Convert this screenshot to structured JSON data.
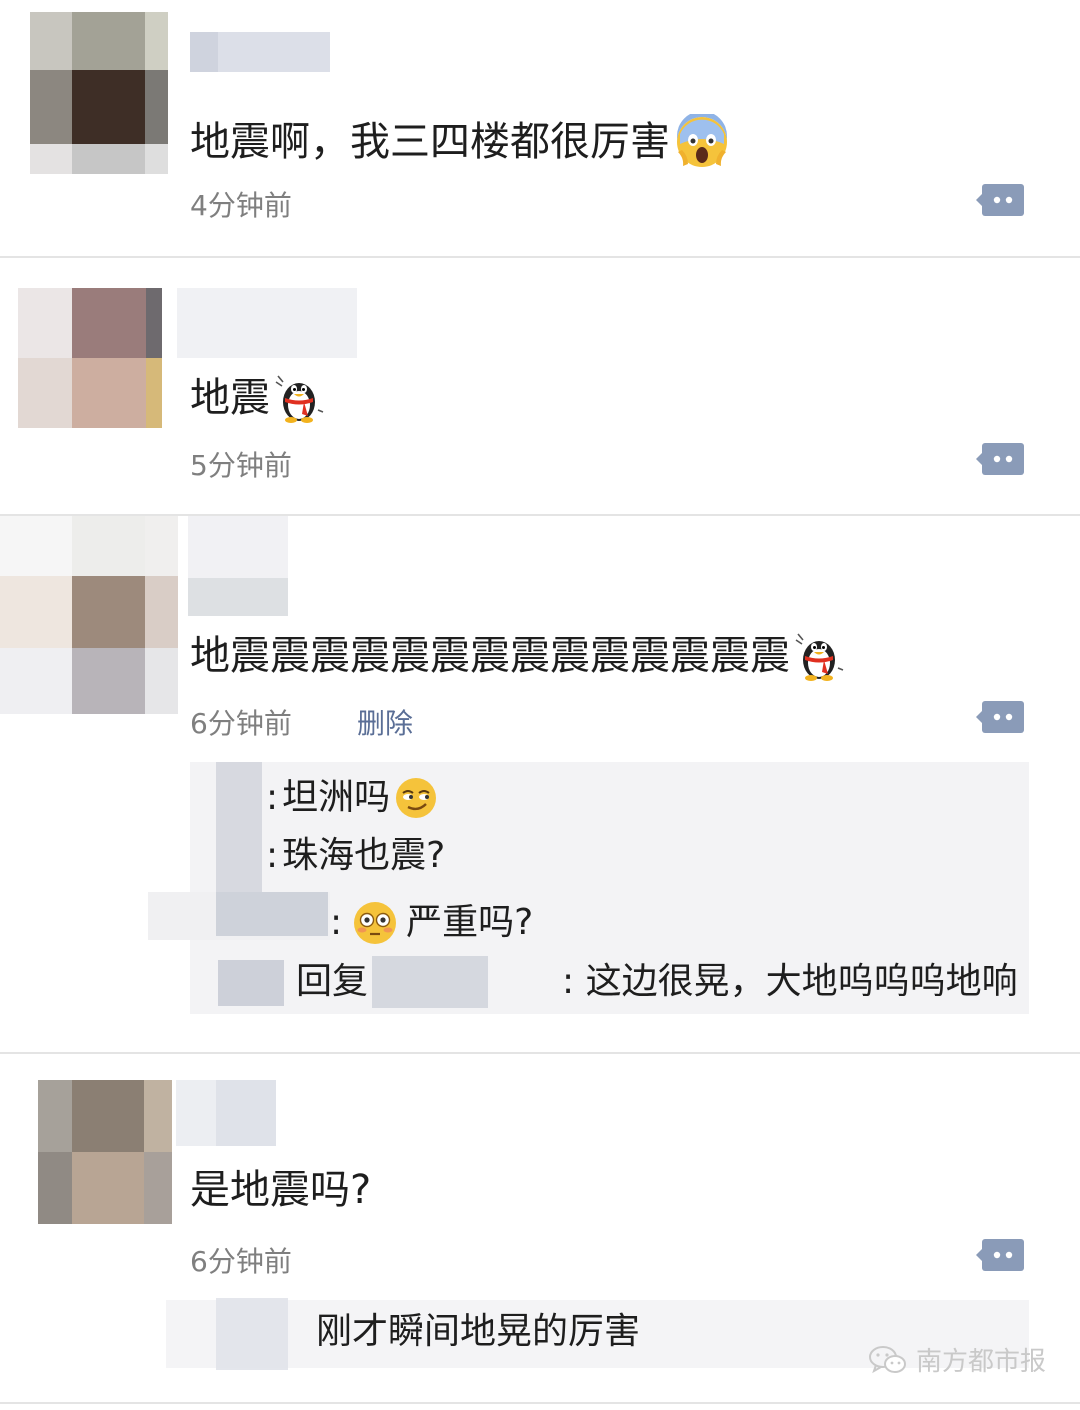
{
  "posts": [
    {
      "content": "地震啊，我三四楼都很厉害",
      "emoji": "scream-face-icon",
      "time": "4分钟前"
    },
    {
      "content": "地震",
      "emoji": "qq-penguin-icon",
      "time": "5分钟前"
    },
    {
      "content": "地震震震震震震震震震震震震震震",
      "emoji": "qq-penguin-icon",
      "time": "6分钟前",
      "delete_label": "删除",
      "replies": [
        {
          "text": "坦洲吗",
          "emoji": "smirk-face-icon"
        },
        {
          "text": "珠海也震?"
        },
        {
          "text": "严重吗?",
          "emoji": "flushed-face-icon"
        },
        {
          "reply_word": "回复",
          "text": ": 这边很晃，大地呜呜呜地响"
        }
      ]
    },
    {
      "content": "是地震吗?",
      "time": "6分钟前",
      "replies": [
        {
          "text": "刚才瞬间地晃的厉害"
        }
      ]
    }
  ],
  "watermark": {
    "text": "南方都市报",
    "icon": "wechat-icon"
  },
  "colors": {
    "link": "#5a6e96",
    "meta": "#7f7f7f",
    "reply_bg": "#f3f3f5",
    "divider": "#e4e4e4",
    "comment_icon": "#8a9bb8"
  }
}
